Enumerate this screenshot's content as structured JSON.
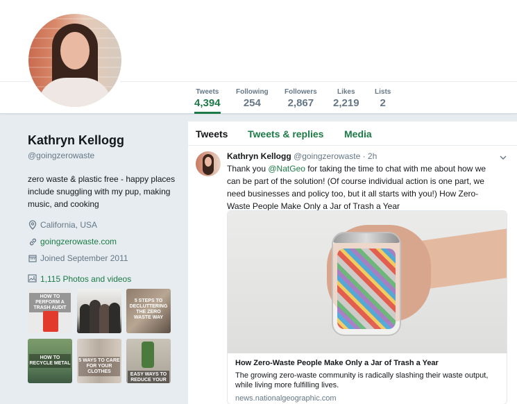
{
  "profile": {
    "name": "Kathryn Kellogg",
    "handle": "@goingzerowaste",
    "bio": "zero waste & plastic free - happy places include snuggling with my pup, making music, and cooking",
    "location": "California, USA",
    "website": "goingzerowaste.com",
    "joined": "Joined September 2011",
    "photos_label": "1,115 Photos and videos"
  },
  "stats": [
    {
      "label": "Tweets",
      "value": "4,394"
    },
    {
      "label": "Following",
      "value": "254"
    },
    {
      "label": "Followers",
      "value": "2,867"
    },
    {
      "label": "Likes",
      "value": "2,219"
    },
    {
      "label": "Lists",
      "value": "2"
    }
  ],
  "tabs": [
    {
      "label": "Tweets"
    },
    {
      "label": "Tweets & replies"
    },
    {
      "label": "Media"
    }
  ],
  "photo_thumbs": [
    {
      "caption": "How to perform a TRASH AUDIT"
    },
    {
      "caption": ""
    },
    {
      "caption": "5 steps to DECLUTTERING the zero waste WAY"
    },
    {
      "caption": "HOW TO recycle metal"
    },
    {
      "caption": "5 ways to care for YOUR CLOTHES"
    },
    {
      "caption": "easy ways to reduce your waste with the BIG FOUR"
    }
  ],
  "tweet": {
    "author_name": "Kathryn Kellogg",
    "author_handle": "@goingzerowaste",
    "time": "· 2h",
    "text_before": "Thank you ",
    "mention": "@NatGeo",
    "text_after": " for taking the time to chat with me about how we can be part of the solution! (Of course individual action is one part, we need businesses and policy too, but it all starts with you!) How Zero-Waste People Make Only a Jar of Trash a Year",
    "card": {
      "title": "How Zero-Waste People Make Only a Jar of Trash a Year",
      "description": "The growing zero-waste community is radically slashing their waste output, while living more fulfilling lives.",
      "domain": "news.nationalgeographic.com"
    }
  },
  "colors": {
    "accent": "#1b7a45",
    "secondary_text": "#657786",
    "background": "#e6ecf0"
  }
}
